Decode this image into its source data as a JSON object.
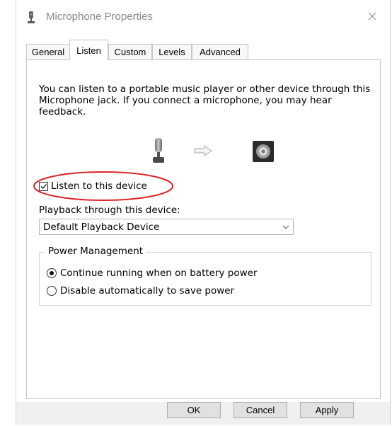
{
  "window": {
    "title": "Microphone Properties",
    "close_glyph": "×"
  },
  "tabs": [
    {
      "label": "General",
      "active": false
    },
    {
      "label": "Listen",
      "active": true
    },
    {
      "label": "Custom",
      "active": false
    },
    {
      "label": "Levels",
      "active": false
    },
    {
      "label": "Advanced",
      "active": false
    }
  ],
  "listen": {
    "description": "You can listen to a portable music player or other device through this Microphone jack.  If you connect a microphone, you may hear feedback.",
    "device_icons": [
      "microphone-icon",
      "arrow-right-icon",
      "speaker-icon"
    ],
    "listen_checkbox": {
      "label": "Listen to this device",
      "checked": true
    },
    "playback_label": "Playback through this device:",
    "playback_device": "Default Playback Device",
    "power_management": {
      "title": "Power Management",
      "options": [
        {
          "label": "Continue running when on battery power",
          "selected": true
        },
        {
          "label": "Disable automatically to save power",
          "selected": false
        }
      ]
    }
  },
  "buttons": {
    "ok": "OK",
    "cancel": "Cancel",
    "apply": "Apply"
  },
  "annotation_color": "#d9252a"
}
